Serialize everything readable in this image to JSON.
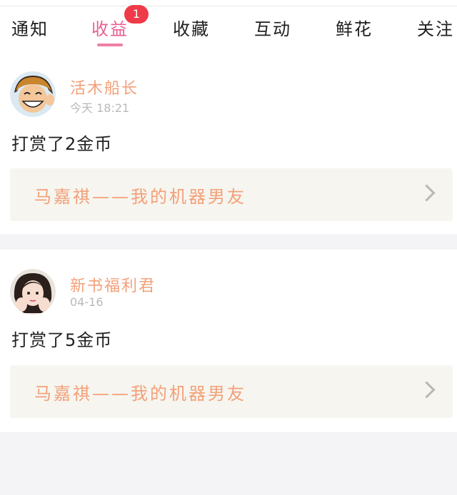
{
  "tabs": [
    {
      "label": "通知"
    },
    {
      "label": "收益",
      "active": true,
      "badge": "1"
    },
    {
      "label": "收藏"
    },
    {
      "label": "互动"
    },
    {
      "label": "鲜花"
    },
    {
      "label": "关注"
    }
  ],
  "colors": {
    "accent": "#e95f93",
    "badge": "#ef3b49",
    "name": "#f3a079"
  },
  "items": [
    {
      "user_name": "活木船长",
      "time": "今天 18:21",
      "action": "打赏了2金币",
      "book_title": "马嘉祺——我的机器男友",
      "avatar_icon": "anime-avatar-icon"
    },
    {
      "user_name": "新书福利君",
      "time": "04-16",
      "action": "打赏了5金币",
      "book_title": "马嘉祺——我的机器男友",
      "avatar_icon": "girl-avatar-icon"
    }
  ]
}
